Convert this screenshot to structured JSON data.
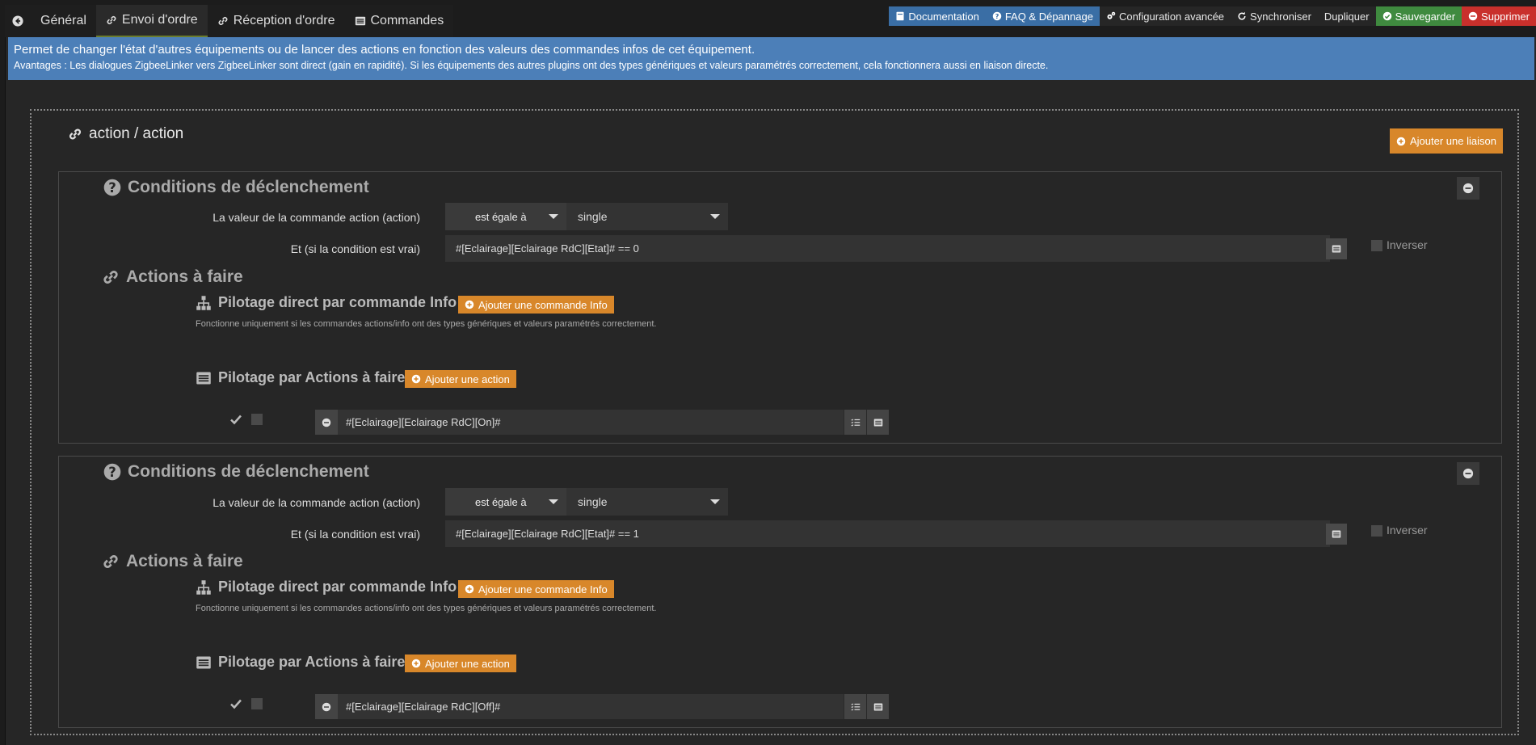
{
  "tabs": [
    {
      "label": ""
    },
    {
      "label": "Général"
    },
    {
      "label": "Envoi d'ordre"
    },
    {
      "label": "Réception d'ordre"
    },
    {
      "label": "Commandes"
    }
  ],
  "toolbar": {
    "documentation": "Documentation",
    "faq": "FAQ & Dépannage",
    "config": "Configuration avancée",
    "sync": "Synchroniser",
    "duplicate": "Dupliquer",
    "save": "Sauvegarder",
    "delete": "Supprimer"
  },
  "banner": {
    "line1": "Permet de changer l'état d'autres équipements ou de lancer des actions en fonction des valeurs des commandes infos de cet équipement.",
    "line2": "Avantages : Les dialogues ZigbeeLinker vers ZigbeeLinker sont direct (gain en rapidité). Si les équipements des autres plugins ont des types génériques et valeurs paramétrés correctement, cela fonctionnera aussi en liaison directe."
  },
  "main": {
    "title": "action / action",
    "add_link": "Ajouter une liaison"
  },
  "blocks": [
    {
      "conditions_title": "Conditions de déclenchement",
      "value_label": "La valeur de la commande action (action)",
      "operator": "est égale à",
      "value": "single",
      "and_label": "Et (si la condition est vrai)",
      "condition": "#[Eclairage][Eclairage RdC][Etat]# == 0",
      "inverse_label": "Inverser",
      "actions_title": "Actions à faire",
      "direct_title": "Pilotage direct par commande Info",
      "add_info": "Ajouter une commande Info",
      "note": "Fonctionne uniquement si les commandes actions/info ont des types génériques et valeurs paramétrés correctement.",
      "actions_sub": "Pilotage par Actions à faire",
      "add_action": "Ajouter une action",
      "action_value": "#[Eclairage][Eclairage RdC][On]#"
    },
    {
      "conditions_title": "Conditions de déclenchement",
      "value_label": "La valeur de la commande action (action)",
      "operator": "est égale à",
      "value": "single",
      "and_label": "Et (si la condition est vrai)",
      "condition": "#[Eclairage][Eclairage RdC][Etat]# == 1",
      "inverse_label": "Inverser",
      "actions_title": "Actions à faire",
      "direct_title": "Pilotage direct par commande Info",
      "add_info": "Ajouter une commande Info",
      "note": "Fonctionne uniquement si les commandes actions/info ont des types génériques et valeurs paramétrés correctement.",
      "actions_sub": "Pilotage par Actions à faire",
      "add_action": "Ajouter une action",
      "action_value": "#[Eclairage][Eclairage RdC][Off]#"
    }
  ],
  "colors": {
    "banner": "#4c7fb8",
    "orange": "#d8872a",
    "save": "#3f8a3f",
    "delete": "#c9302c",
    "doc": "#3a6ea5"
  }
}
